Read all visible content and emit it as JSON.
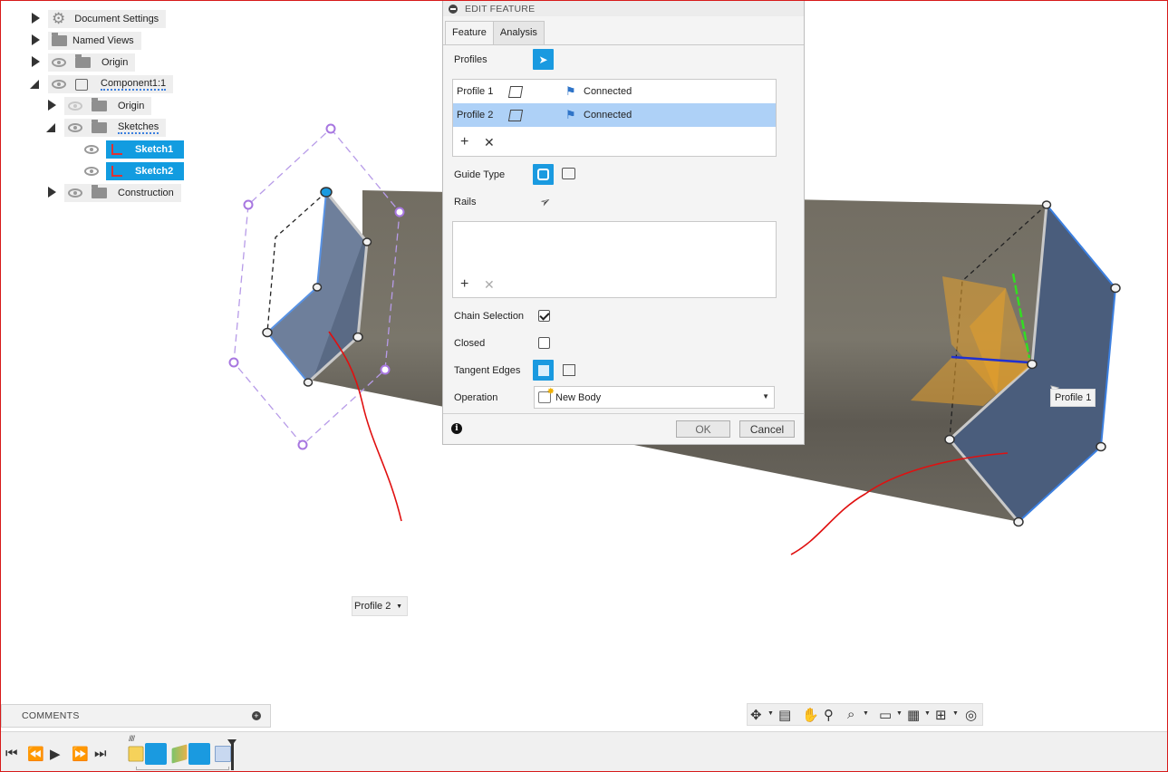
{
  "browser": {
    "items": [
      {
        "label": "Document Settings"
      },
      {
        "label": "Named Views"
      },
      {
        "label": "Origin"
      },
      {
        "label": "Component1:1"
      },
      {
        "label": "Origin"
      },
      {
        "label": "Sketches"
      },
      {
        "label": "Sketch1"
      },
      {
        "label": "Sketch2"
      },
      {
        "label": "Construction"
      }
    ]
  },
  "dialog": {
    "title": "EDIT FEATURE",
    "tabs": [
      {
        "label": "Feature"
      },
      {
        "label": "Analysis"
      }
    ],
    "profiles_label": "Profiles",
    "profiles": [
      {
        "name": "Profile 1",
        "status": "Connected"
      },
      {
        "name": "Profile 2",
        "status": "Connected"
      }
    ],
    "guide_type_label": "Guide Type",
    "rails_label": "Rails",
    "chain_selection_label": "Chain Selection",
    "chain_selection_checked": true,
    "closed_label": "Closed",
    "closed_checked": false,
    "tangent_edges_label": "Tangent Edges",
    "operation_label": "Operation",
    "operation_value": "New Body",
    "ok_label": "OK",
    "cancel_label": "Cancel"
  },
  "viewport": {
    "profile1_tag": "Profile 1",
    "profile2_dropdown": "Profile 2"
  },
  "comments": {
    "label": "COMMENTS"
  },
  "colors": {
    "accent": "#1a9ae0",
    "selection": "#aed1f7",
    "body": "#77736a",
    "profile_fill": "#4d607e",
    "annotation": "#e01010"
  }
}
